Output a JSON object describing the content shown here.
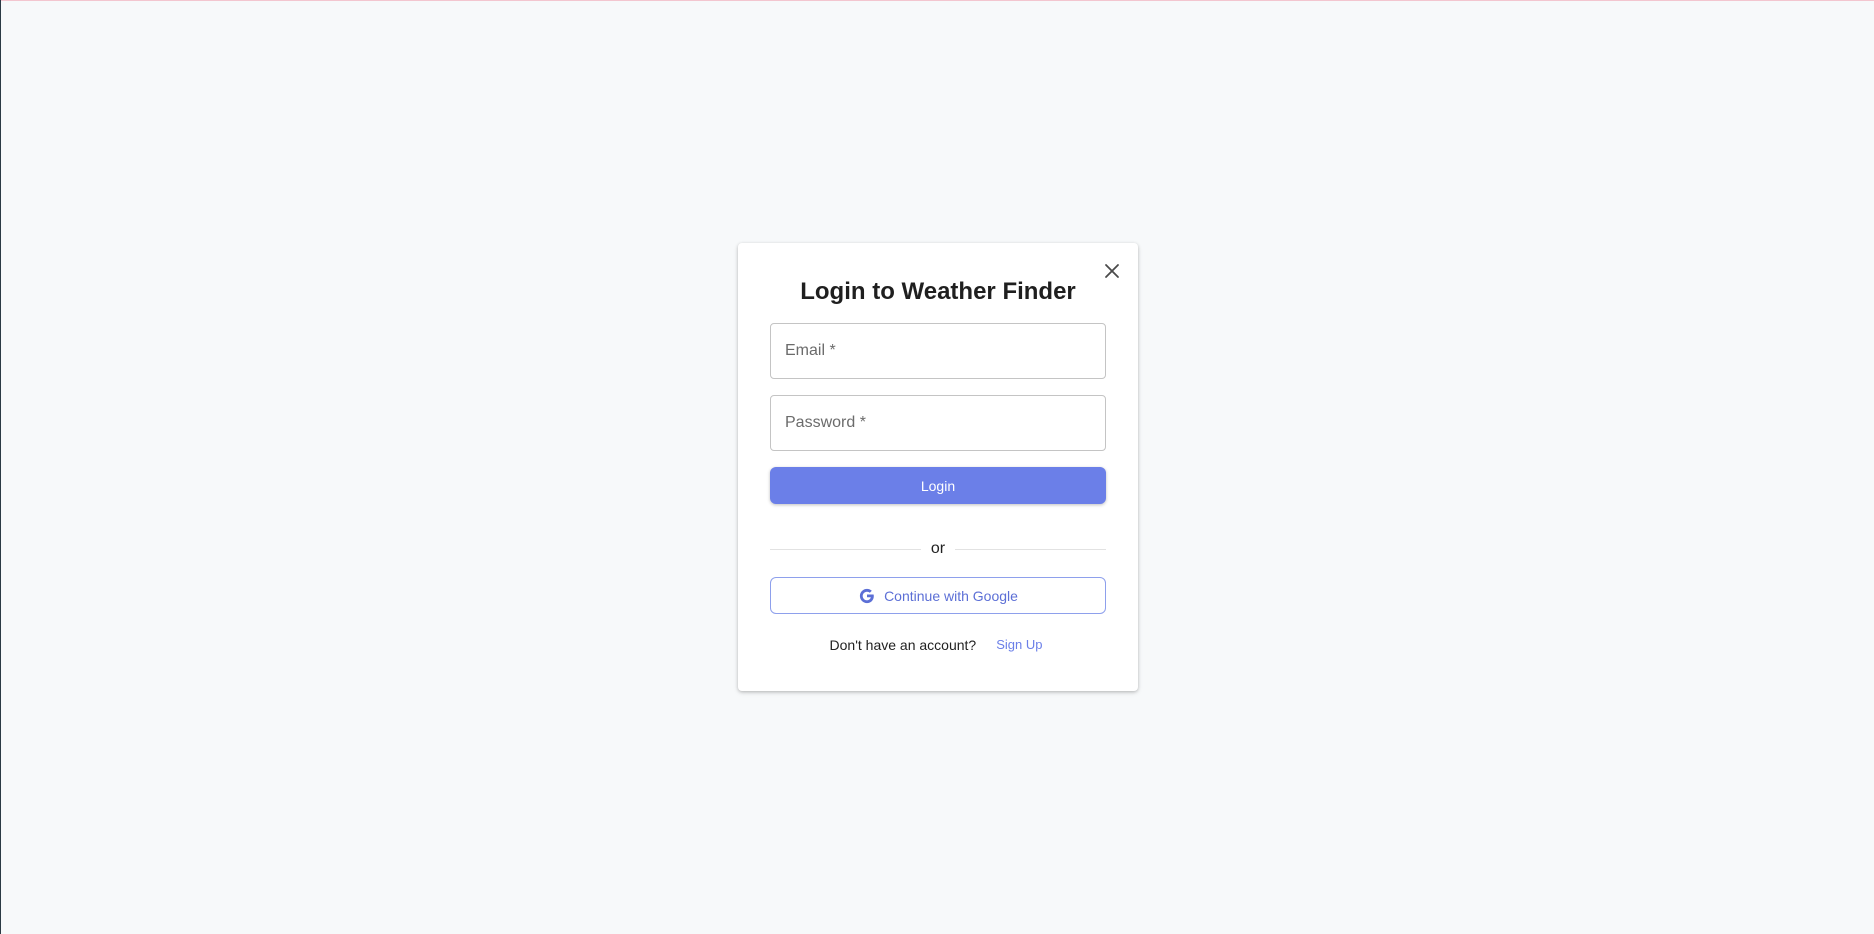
{
  "dialog": {
    "title": "Login to Weather Finder",
    "close_icon": "close-icon"
  },
  "form": {
    "email_label": "Email *",
    "email_value": "",
    "password_label": "Password *",
    "password_value": "",
    "login_label": "Login"
  },
  "divider": {
    "text": "or"
  },
  "google": {
    "label": "Continue with Google",
    "icon": "google-g-icon"
  },
  "signup": {
    "prompt": "Don't have an account?",
    "link": "Sign Up"
  },
  "colors": {
    "accent": "#6b7fe8",
    "background": "#f7f9fa"
  }
}
